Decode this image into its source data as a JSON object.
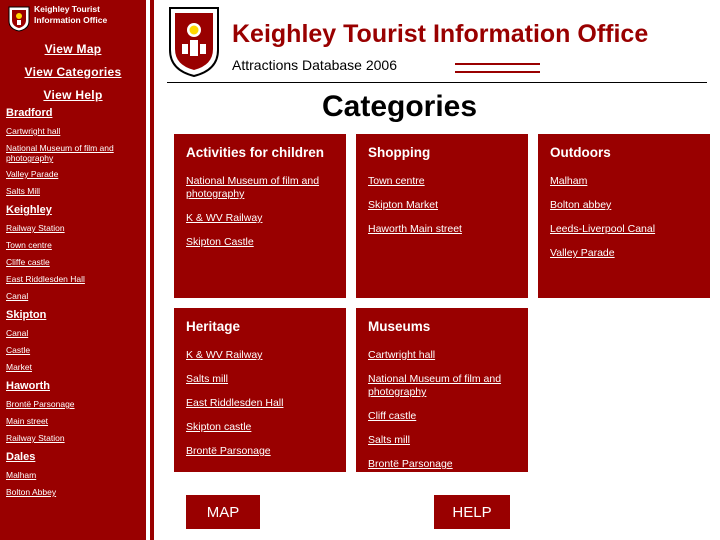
{
  "sidebar": {
    "org_title": "Keighley Tourist Information Office",
    "nav": [
      {
        "label": "View Map",
        "name": "view-map"
      },
      {
        "label": "View Categories",
        "name": "view-categories"
      },
      {
        "label": "View Help",
        "name": "view-help"
      }
    ],
    "groups": [
      {
        "heading": "Bradford",
        "items": [
          "Cartwright hall",
          "National Museum of film and photography",
          "Valley Parade",
          "Salts Mill"
        ]
      },
      {
        "heading": "Keighley",
        "items": [
          "Railway Station",
          "Town centre",
          "Cliffe castle",
          "East Riddlesden Hall",
          "Canal"
        ]
      },
      {
        "heading": "Skipton",
        "items": [
          "Canal",
          "Castle",
          "Market"
        ]
      },
      {
        "heading": "Haworth",
        "items": [
          "Brontë Parsonage",
          "Main street",
          "Railway Station"
        ]
      },
      {
        "heading": "Dales",
        "items": [
          "Malham",
          "Bolton Abbey"
        ]
      }
    ]
  },
  "header": {
    "title": "Keighley Tourist Information Office",
    "subtitle": "Attractions Database 2006",
    "section_heading": "Categories"
  },
  "cards": [
    {
      "id": "activities",
      "title": "Activities for children",
      "links": [
        "National Museum of film and photography",
        "K & WV Railway",
        "Skipton Castle"
      ]
    },
    {
      "id": "shopping",
      "title": "Shopping",
      "links": [
        "Town centre",
        "Skipton Market",
        "Haworth Main street"
      ]
    },
    {
      "id": "outdoors",
      "title": "Outdoors",
      "links": [
        "Malham",
        "Bolton abbey",
        "Leeds-Liverpool Canal",
        "Valley Parade"
      ]
    },
    {
      "id": "heritage",
      "title": "Heritage",
      "links": [
        "K & WV Railway",
        "Salts mill",
        "East Riddlesden Hall",
        "Skipton castle",
        "Brontë Parsonage"
      ]
    },
    {
      "id": "museums",
      "title": "Museums",
      "links": [
        "Cartwright hall",
        "National Museum of film and photography",
        "Cliff castle",
        "Salts mill",
        "Brontë Parsonage"
      ]
    }
  ],
  "buttons": {
    "map": "MAP",
    "help": "HELP"
  },
  "colors": {
    "brand_red": "#990000",
    "text_white": "#ffffff",
    "text_black": "#000000"
  }
}
